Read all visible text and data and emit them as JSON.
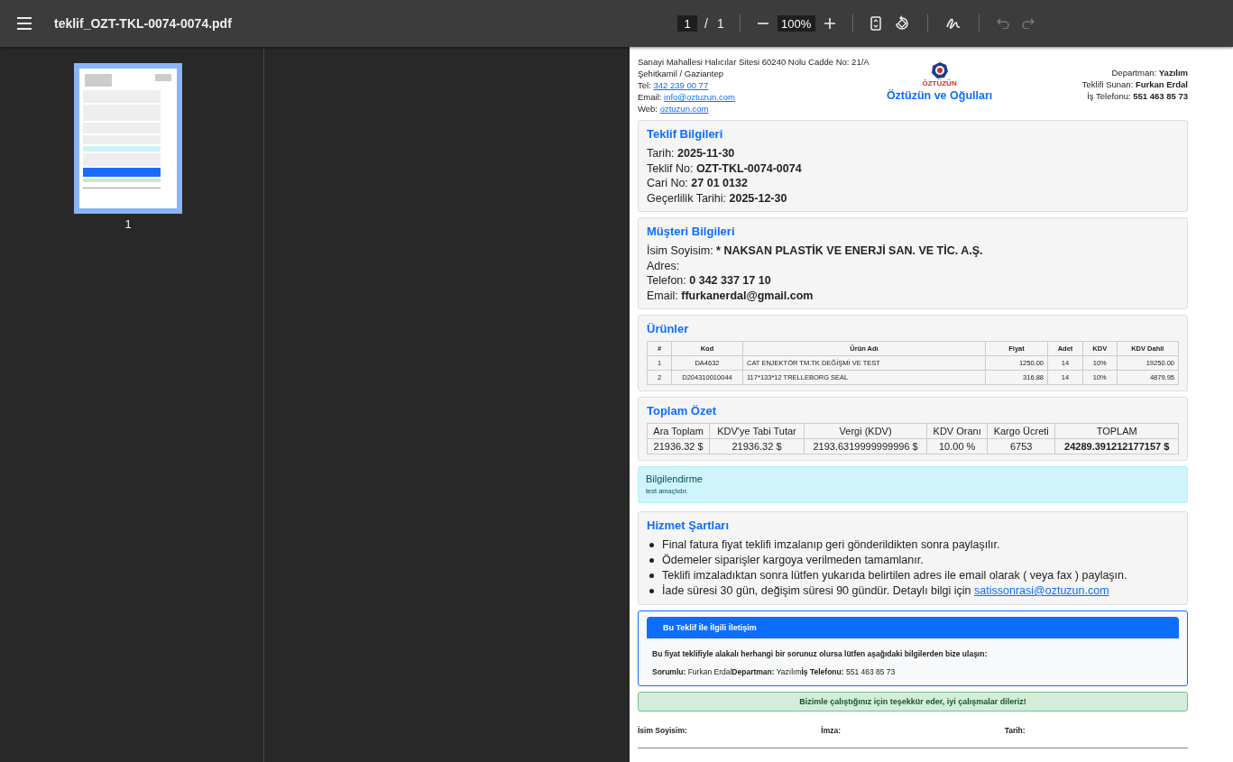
{
  "toolbar": {
    "title": "teklif_OZT-TKL-0074-0074.pdf",
    "page_input": "1",
    "page_separator": "/",
    "page_count": "1",
    "zoom": "100%",
    "undo_disabled": true,
    "redo_disabled": true
  },
  "sidebar": {
    "thumbnails": [
      {
        "label": "1",
        "selected": true
      }
    ]
  },
  "document": {
    "company_address": [
      {
        "text": "Sanayi Mahallesi Halıcılar Sitesi 60240 Nolu Cadde No: 21/A"
      },
      {
        "text": "Şehitkamil / Gaziantep"
      },
      {
        "label": "Tel:",
        "link": "342 239 00 77"
      },
      {
        "label": "Email:",
        "link": "info@oztuzun.com"
      },
      {
        "label": "Web:",
        "link": "oztuzun.com"
      }
    ],
    "logo_text": "ÖZTÜZÜN",
    "company_name": "Öztüzün ve Oğulları",
    "contact_info": [
      {
        "label": "Departman:",
        "value": "Yazılım"
      },
      {
        "label": "Teklifi Sunan:",
        "value": "Furkan Erdal"
      },
      {
        "label": "İş Telefonu:",
        "value": "551 463 85 73"
      }
    ],
    "sections": [
      {
        "kind": "fields",
        "title": "Teklif Bilgileri",
        "fields": [
          {
            "label": "Tarih:",
            "value": "2025-11-30"
          },
          {
            "label": "Teklif No:",
            "value": "OZT-TKL-0074-0074"
          },
          {
            "label": "Cari No:",
            "value": "27 01 0132"
          },
          {
            "label": "Geçerlilik Tarihi:",
            "value": "2025-12-30"
          }
        ]
      },
      {
        "kind": "fields",
        "title": "Müşteri Bilgileri",
        "fields": [
          {
            "label": "İsim Soyisim:",
            "value": "* NAKSAN PLASTİK VE ENERJİ SAN. VE TİC. A.Ş."
          },
          {
            "label": "Adres:"
          },
          {
            "label": "Telefon:",
            "value": "0 342 337 17 10"
          },
          {
            "label": "Email:",
            "value": "ffurkanerdal@gmail.com"
          }
        ]
      },
      {
        "kind": "products",
        "title": "Ürünler",
        "columns": [
          "#",
          "Kod",
          "Ürün Adı",
          "Fiyat",
          "Adet",
          "KDV",
          "KDV Dahil"
        ],
        "rows": [
          [
            "1",
            "DA4632",
            "CAT ENJEKTÖR TM.TK DEĞİŞMİ VE TEST",
            "1250.00",
            "14",
            "10%",
            "19250.00"
          ],
          [
            "2",
            "D204310010044",
            "117*133*12 TRELLEBORG SEAL",
            "316.88",
            "14",
            "10%",
            "4879.95"
          ]
        ]
      },
      {
        "kind": "summary",
        "title": "Toplam Özet",
        "columns": [
          "Ara Toplam",
          "KDV'ye Tabi Tutar",
          "Vergi (KDV)",
          "KDV Oranı",
          "Kargo Ücreti",
          "TOPLAM"
        ],
        "values": [
          "21936.32 $",
          "21936.32 $",
          "2193.6319999999996 $",
          "10.00 %",
          "6753",
          "24289.391212177157 $"
        ]
      },
      {
        "kind": "notice",
        "title": "Bilgilendirme",
        "text": "test amaçlıdır."
      },
      {
        "kind": "terms",
        "title": "Hizmet Şartları",
        "items": [
          {
            "text": "Final fatura fiyat teklifi imzalanıp geri gönderildikten sonra paylaşılır."
          },
          {
            "text": "Ödemeler siparişler kargoya verilmeden tamamlanır."
          },
          {
            "text": "Teklifi imzaladıktan sonra lütfen yukarıda belirtilen adres ile email olarak ( veya fax ) paylaşın."
          },
          {
            "text": "İade süresi 30 gün, değişim süresi 90 gündür. Detaylı bilgi için",
            "link": "satissonrasi@oztuzun.com"
          }
        ]
      },
      {
        "kind": "contact",
        "title": "Bu Teklif İle İlgili İletişim",
        "text": "Bu fiyat teklifiyle alakalı herhangi bir sorunuz olursa lütfen aşağıdaki bilgilerden bize ulaşın:",
        "fields": [
          {
            "label": "Sorumlu:",
            "value": "Furkan Erdal"
          },
          {
            "label": "Departman:",
            "value": "Yazılım"
          },
          {
            "label": "İş Telefonu:",
            "value": "551 463 85 73"
          }
        ]
      },
      {
        "kind": "thanks",
        "text": "Bizimle çalıştığınız için teşekkür eder, iyi çalışmalar dileriz!"
      }
    ],
    "signatures": [
      "İsim Soyisim:",
      "İmza:",
      "Tarih:"
    ]
  }
}
